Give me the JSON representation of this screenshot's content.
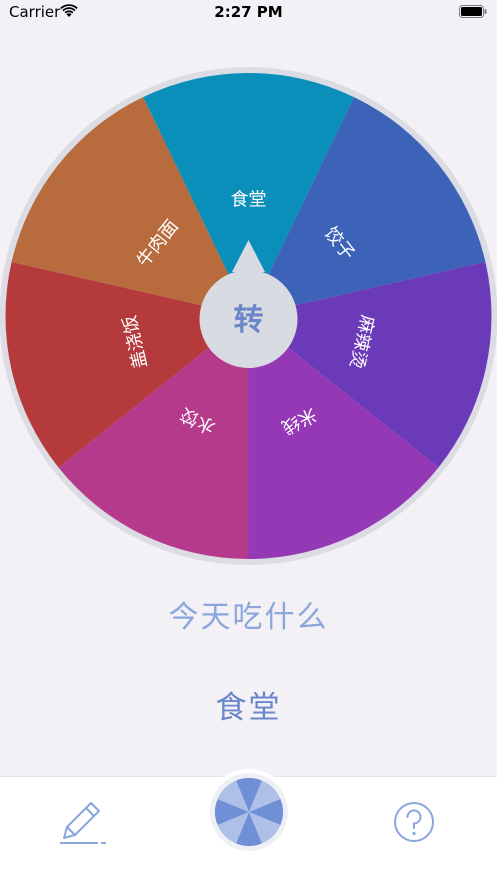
{
  "status_bar": {
    "carrier": "Carrier",
    "time": "2:27 PM"
  },
  "wheel": {
    "segments": [
      {
        "label": "食堂",
        "color": "#0a8fba"
      },
      {
        "label": "饺子",
        "color": "#3c63b8"
      },
      {
        "label": "麻辣烫",
        "color": "#6b3ab8"
      },
      {
        "label": "米线",
        "color": "#9438b5"
      },
      {
        "label": "水饺",
        "color": "#b53a8c"
      },
      {
        "label": "盖浇饭",
        "color": "#b53a3c"
      },
      {
        "label": "牛肉面",
        "color": "#b86b3c"
      }
    ],
    "center_label": "转",
    "rim_color": "#dcdce4",
    "hub_color": "#d9dbe3",
    "hub_text_color": "#6b86c6"
  },
  "question": "今天吃什么",
  "result": "食堂",
  "tab_bar": {
    "edit_icon": "pencil-icon",
    "spin_icon": "wheel-icon",
    "help_icon": "question-circle-icon",
    "accent_color": "#8aa6dc"
  }
}
